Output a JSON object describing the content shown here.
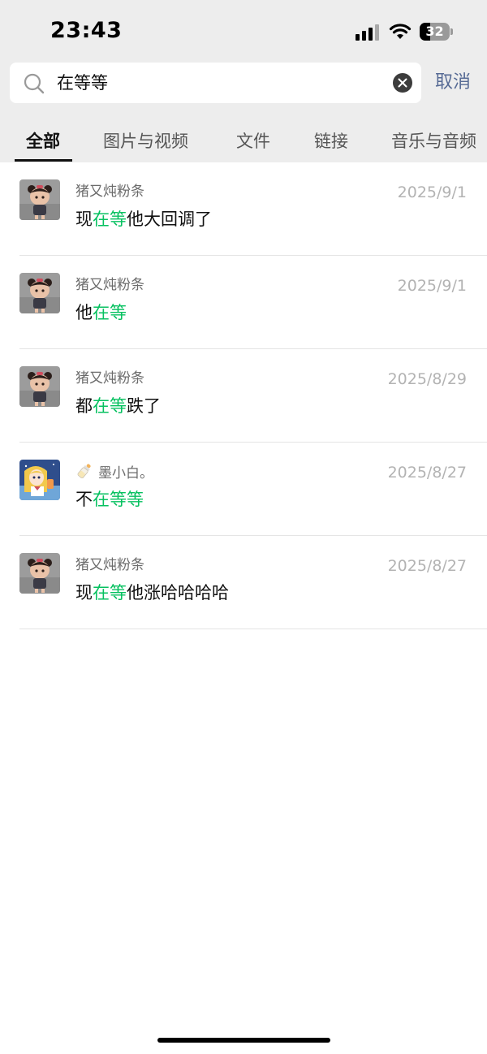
{
  "status_bar": {
    "time": "23:43",
    "battery": "32",
    "icons": [
      "signal-icon",
      "wifi-icon",
      "battery-icon"
    ]
  },
  "search": {
    "query": "在等等",
    "cancel_label": "取消"
  },
  "tabs": [
    {
      "label": "全部",
      "active": true
    },
    {
      "label": "图片与视频",
      "active": false
    },
    {
      "label": "文件",
      "active": false
    },
    {
      "label": "链接",
      "active": false
    },
    {
      "label": "音乐与音频",
      "active": false
    }
  ],
  "results": [
    {
      "sender": "猪又炖粉条",
      "date": "2025/9/1",
      "message": {
        "pre": "现",
        "hl": "在等",
        "post": "他大回调了"
      }
    },
    {
      "sender": "猪又炖粉条",
      "date": "2025/9/1",
      "message": {
        "pre": "他",
        "hl": "在等",
        "post": ""
      }
    },
    {
      "sender": "猪又炖粉条",
      "date": "2025/8/29",
      "message": {
        "pre": "都",
        "hl": "在等",
        "post": "跌了"
      }
    },
    {
      "sender": "墨小白。",
      "sender_prefix_icon": "baby-bottle-icon",
      "date": "2025/8/27",
      "message": {
        "pre": "不",
        "hl": "在等等",
        "post": ""
      }
    },
    {
      "sender": "猪又炖粉条",
      "date": "2025/8/27",
      "message": {
        "pre": "现",
        "hl": "在等",
        "post": "他涨哈哈哈哈"
      }
    }
  ],
  "colors": {
    "highlight": "#07c160",
    "link": "#576b95",
    "header_bg": "#ededed"
  }
}
